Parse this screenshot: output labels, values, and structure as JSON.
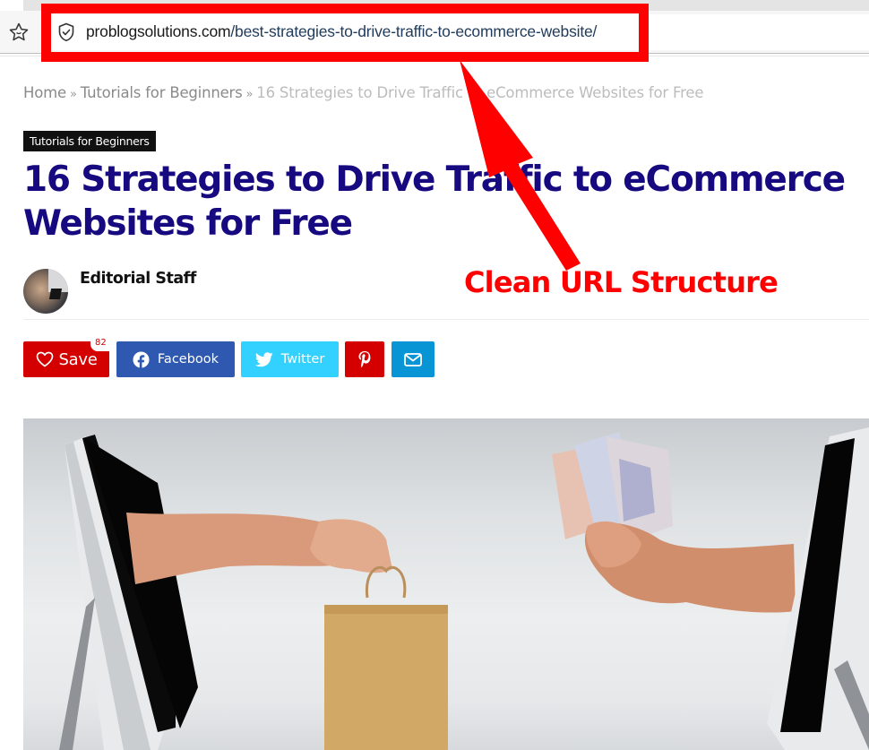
{
  "browser": {
    "address_bar": {
      "domain": "problogsolutions.com",
      "path": "/best-strategies-to-drive-traffic-to-ecommerce-website/"
    },
    "icons": {
      "bookmark": "star-icon",
      "security": "shield-check-icon"
    }
  },
  "breadcrumb": {
    "items": [
      {
        "label": "Home"
      },
      {
        "label": "Tutorials for Beginners"
      },
      {
        "label": "16 Strategies to Drive Traffic to eCommerce Websites for Free"
      }
    ],
    "separator": "»"
  },
  "article": {
    "category": "Tutorials for Beginners",
    "title": "16 Strategies to Drive Traffic to eCommerce Websites for Free",
    "author": "Editorial Staff"
  },
  "share": {
    "save": {
      "label": "Save",
      "count": "82",
      "icon": "heart-icon",
      "color": "#d40000"
    },
    "facebook": {
      "label": "Facebook",
      "icon": "facebook-icon",
      "color": "#2f59b0"
    },
    "twitter": {
      "label": "Twitter",
      "icon": "twitter-icon",
      "color": "#33d1ff"
    },
    "pinterest": {
      "icon": "pinterest-icon",
      "color": "#d40000"
    },
    "email": {
      "icon": "mail-icon",
      "color": "#0795d6"
    }
  },
  "hero_image": {
    "description": "Two hands reaching out of computer monitors exchanging a paper shopping bag for euro banknotes"
  },
  "annotation": {
    "callout": "Clean URL Structure",
    "color": "#ff0000"
  },
  "colors": {
    "title": "#170a80",
    "badge_bg": "#111111"
  }
}
